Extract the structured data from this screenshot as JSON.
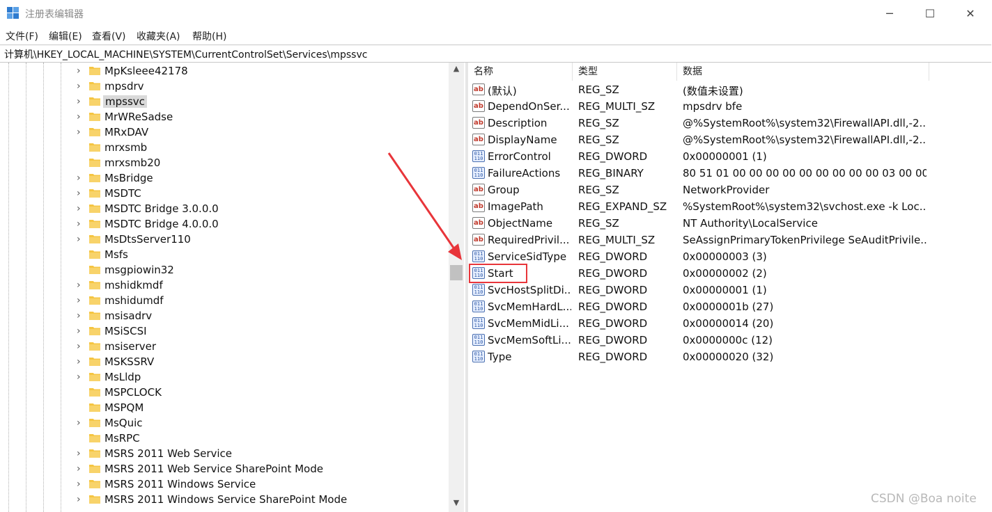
{
  "window": {
    "title": "注册表编辑器",
    "app_icon": "regedit-icon",
    "controls": {
      "minimize": "─",
      "maximize": "☐",
      "close": "✕"
    }
  },
  "menu": {
    "items": [
      "文件(F)",
      "编辑(E)",
      "查看(V)",
      "收藏夹(A)",
      "帮助(H)"
    ]
  },
  "address": {
    "path": "计算机\\HKEY_LOCAL_MACHINE\\SYSTEM\\CurrentControlSet\\Services\\mpssvc"
  },
  "tree": {
    "items": [
      {
        "label": "MpKsleee42178",
        "expandable": true
      },
      {
        "label": "mpsdrv",
        "expandable": true
      },
      {
        "label": "mpssvc",
        "expandable": true,
        "selected": true
      },
      {
        "label": "MrWReSadse",
        "expandable": true
      },
      {
        "label": "MRxDAV",
        "expandable": true
      },
      {
        "label": "mrxsmb",
        "expandable": false
      },
      {
        "label": "mrxsmb20",
        "expandable": false
      },
      {
        "label": "MsBridge",
        "expandable": true
      },
      {
        "label": "MSDTC",
        "expandable": true
      },
      {
        "label": "MSDTC Bridge 3.0.0.0",
        "expandable": true
      },
      {
        "label": "MSDTC Bridge 4.0.0.0",
        "expandable": true
      },
      {
        "label": "MsDtsServer110",
        "expandable": true
      },
      {
        "label": "Msfs",
        "expandable": false
      },
      {
        "label": "msgpiowin32",
        "expandable": false
      },
      {
        "label": "mshidkmdf",
        "expandable": true
      },
      {
        "label": "mshidumdf",
        "expandable": true
      },
      {
        "label": "msisadrv",
        "expandable": true
      },
      {
        "label": "MSiSCSI",
        "expandable": true
      },
      {
        "label": "msiserver",
        "expandable": true
      },
      {
        "label": "MSKSSRV",
        "expandable": true
      },
      {
        "label": "MsLldp",
        "expandable": true
      },
      {
        "label": "MSPCLOCK",
        "expandable": false
      },
      {
        "label": "MSPQM",
        "expandable": false
      },
      {
        "label": "MsQuic",
        "expandable": true
      },
      {
        "label": "MsRPC",
        "expandable": false
      },
      {
        "label": "MSRS 2011 Web Service",
        "expandable": true
      },
      {
        "label": "MSRS 2011 Web Service SharePoint Mode",
        "expandable": true
      },
      {
        "label": "MSRS 2011 Windows Service",
        "expandable": true
      },
      {
        "label": "MSRS 2011 Windows Service SharePoint Mode",
        "expandable": true
      }
    ]
  },
  "values": {
    "columns": {
      "name": "名称",
      "type": "类型",
      "data": "数据"
    },
    "rows": [
      {
        "icon": "ab",
        "name": "(默认)",
        "type": "REG_SZ",
        "data": "(数值未设置)"
      },
      {
        "icon": "ab",
        "name": "DependOnSer...",
        "type": "REG_MULTI_SZ",
        "data": "mpsdrv bfe"
      },
      {
        "icon": "ab",
        "name": "Description",
        "type": "REG_SZ",
        "data": "@%SystemRoot%\\system32\\FirewallAPI.dll,-2..."
      },
      {
        "icon": "ab",
        "name": "DisplayName",
        "type": "REG_SZ",
        "data": "@%SystemRoot%\\system32\\FirewallAPI.dll,-2..."
      },
      {
        "icon": "bin",
        "name": "ErrorControl",
        "type": "REG_DWORD",
        "data": "0x00000001 (1)"
      },
      {
        "icon": "bin",
        "name": "FailureActions",
        "type": "REG_BINARY",
        "data": "80 51 01 00 00 00 00 00 00 00 00 00 03 00 00 ..."
      },
      {
        "icon": "ab",
        "name": "Group",
        "type": "REG_SZ",
        "data": "NetworkProvider"
      },
      {
        "icon": "ab",
        "name": "ImagePath",
        "type": "REG_EXPAND_SZ",
        "data": "%SystemRoot%\\system32\\svchost.exe -k Loc..."
      },
      {
        "icon": "ab",
        "name": "ObjectName",
        "type": "REG_SZ",
        "data": "NT Authority\\LocalService"
      },
      {
        "icon": "ab",
        "name": "RequiredPrivil...",
        "type": "REG_MULTI_SZ",
        "data": "SeAssignPrimaryTokenPrivilege SeAuditPrivile..."
      },
      {
        "icon": "bin",
        "name": "ServiceSidType",
        "type": "REG_DWORD",
        "data": "0x00000003 (3)"
      },
      {
        "icon": "bin",
        "name": "Start",
        "type": "REG_DWORD",
        "data": "0x00000002 (2)",
        "highlighted": true
      },
      {
        "icon": "bin",
        "name": "SvcHostSplitDi...",
        "type": "REG_DWORD",
        "data": "0x00000001 (1)"
      },
      {
        "icon": "bin",
        "name": "SvcMemHardL...",
        "type": "REG_DWORD",
        "data": "0x0000001b (27)"
      },
      {
        "icon": "bin",
        "name": "SvcMemMidLi...",
        "type": "REG_DWORD",
        "data": "0x00000014 (20)"
      },
      {
        "icon": "bin",
        "name": "SvcMemSoftLi...",
        "type": "REG_DWORD",
        "data": "0x0000000c (12)"
      },
      {
        "icon": "bin",
        "name": "Type",
        "type": "REG_DWORD",
        "data": "0x00000020 (32)"
      }
    ]
  },
  "annotation": {
    "color": "#e8353a"
  },
  "watermark": {
    "text": "CSDN @Boa noite"
  }
}
